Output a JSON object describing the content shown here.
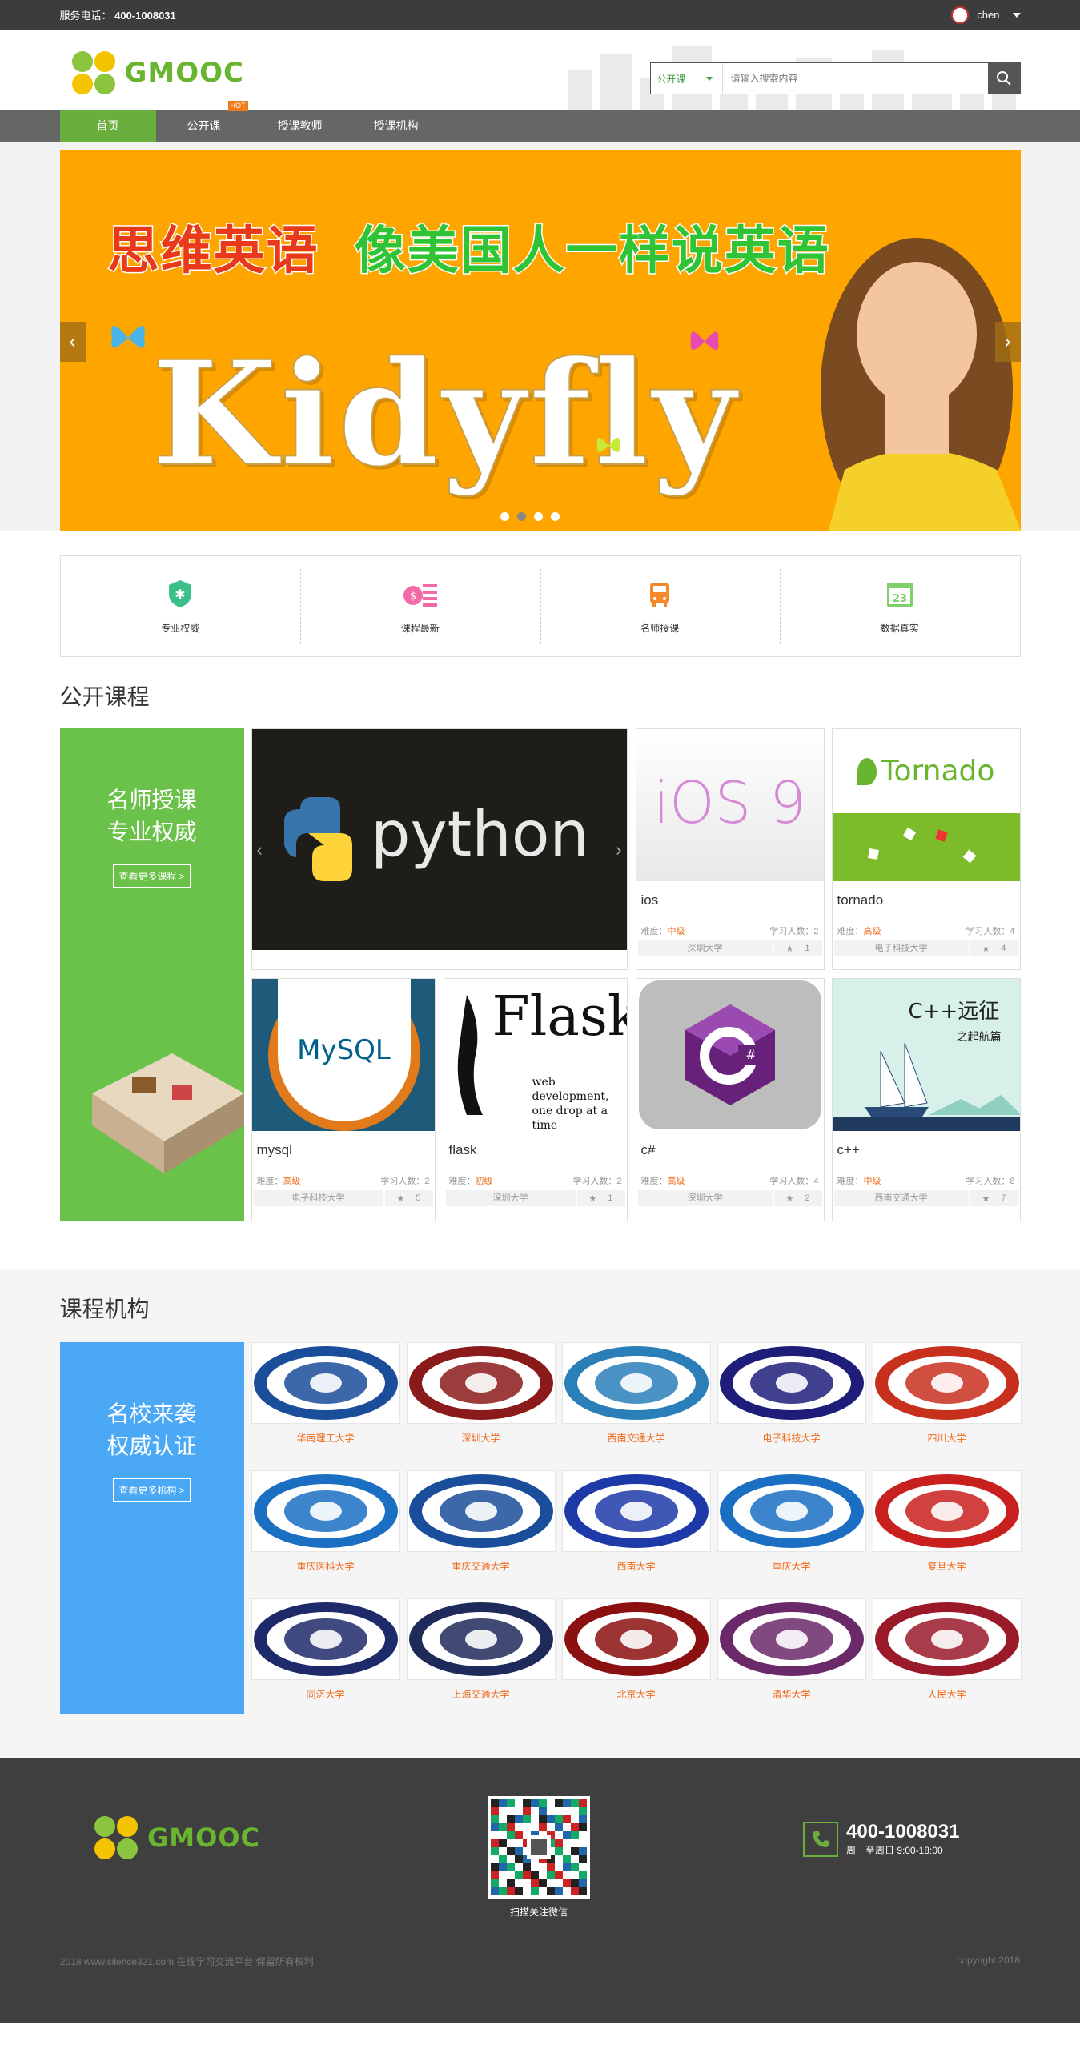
{
  "topbar": {
    "phone_label": "服务电话：",
    "phone": "400-1008031",
    "username": "chen"
  },
  "header": {
    "logo_text": "GMOOC"
  },
  "search": {
    "category": "公开课",
    "placeholder": "请输入搜索内容"
  },
  "nav": {
    "hot_badge": "HOT",
    "items": [
      "首页",
      "公开课",
      "授课教师",
      "授课机构"
    ]
  },
  "banner": {
    "slogan_1": "思维英语",
    "slogan_2": "像美国人一样说英语",
    "brand": "Kidyfly"
  },
  "features": [
    "专业权威",
    "课程最新",
    "名师授课",
    "数据真实"
  ],
  "courses_section": {
    "title": "公开课程",
    "promo_line1": "名师授课",
    "promo_line2": "专业权威",
    "promo_more": "查看更多课程 >",
    "level_label": "难度：",
    "learners_label": "学习人数：",
    "items": [
      {
        "name": "ios",
        "level": "中级",
        "learners": "2",
        "org": "深圳大学",
        "favs": "1"
      },
      {
        "name": "tornado",
        "level": "高级",
        "learners": "4",
        "org": "电子科技大学",
        "favs": "4"
      },
      {
        "name": "mysql",
        "level": "高级",
        "learners": "2",
        "org": "电子科技大学",
        "favs": "5"
      },
      {
        "name": "flask",
        "level": "初级",
        "learners": "2",
        "org": "深圳大学",
        "favs": "1"
      },
      {
        "name": "c#",
        "level": "高级",
        "learners": "4",
        "org": "深圳大学",
        "favs": "2"
      },
      {
        "name": "c++",
        "level": "中级",
        "learners": "8",
        "org": "西南交通大学",
        "favs": "7"
      }
    ],
    "image_text": {
      "python": "python",
      "ios": "iOS 9",
      "tornado": "Tornado",
      "flask_title": "Flask",
      "flask_sub1": "web development,",
      "flask_sub2": "one drop at a time",
      "cpp": "C++远征",
      "cpp_sub": "之起航篇",
      "mysql": "MySQL"
    }
  },
  "orgs_section": {
    "title": "课程机构",
    "promo_line1": "名校来袭",
    "promo_line2": "权威认证",
    "promo_more": "查看更多机构 >",
    "items": [
      "华南理工大学",
      "深圳大学",
      "西南交通大学",
      "电子科技大学",
      "四川大学",
      "重庆医科大学",
      "重庆交通大学",
      "西南大学",
      "重庆大学",
      "复旦大学",
      "同济大学",
      "上海交通大学",
      "北京大学",
      "清华大学",
      "人民大学"
    ],
    "seal_colors": [
      "#1a4e9b",
      "#8b1a1a",
      "#2a7fb8",
      "#1e1e7a",
      "#c8301e",
      "#1a6fc2",
      "#1a4e9b",
      "#1e3aa8",
      "#1a6fc2",
      "#c8201e",
      "#1e2a6a",
      "#1e2a5a",
      "#8b1010",
      "#6a2a6a",
      "#9a1a2a"
    ]
  },
  "footer": {
    "logo_text": "GMOOC",
    "qr_label": "扫描关注微信",
    "tel": "400-1008031",
    "hours": "周一至周日 9:00-18:00",
    "copyright_left": "2018 www.silence321.com 在线学习交流平台 保留所有权利",
    "copyright_right": "copyright 2018"
  },
  "colors": {
    "brand_green": "#6ab530",
    "nav_active": "#6aaf3d",
    "level_orange": "#f06a1a",
    "banner_bg": "#ffa500",
    "org_promo_blue": "#4aa8f5",
    "course_promo_green": "#6bc24a"
  }
}
